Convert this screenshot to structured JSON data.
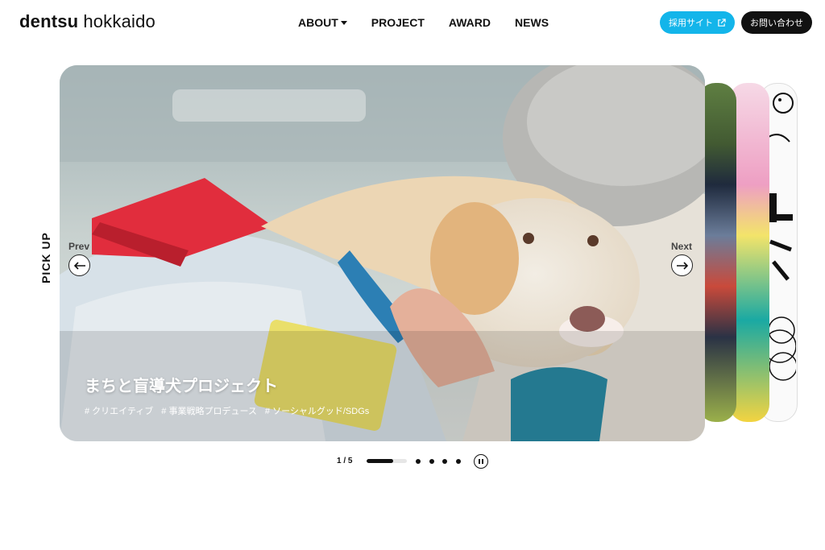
{
  "header": {
    "logo_bold": "dentsu",
    "logo_light": "hokkaido",
    "nav": [
      {
        "label": "ABOUT",
        "has_caret": true
      },
      {
        "label": "PROJECT"
      },
      {
        "label": "AWARD"
      },
      {
        "label": "NEWS"
      }
    ],
    "recruit_label": "採用サイト",
    "contact_label": "お問い合わせ"
  },
  "section_label": "PICK UP",
  "slider": {
    "prev_label": "Prev",
    "next_label": "Next",
    "current": {
      "title": "まちと盲導犬プロジェクト",
      "tags": [
        "# クリエイティブ",
        "# 事業戦略プロデュース",
        "# ソーシャルグッド/SDGs"
      ]
    },
    "counter": "1 / 5",
    "progress": 0.65,
    "dots": 4
  },
  "colors": {
    "recruit_button": "#13b5ea",
    "contact_button": "#111111",
    "text": "#111111"
  },
  "icons": {
    "recruit": "external-link-icon",
    "prev": "arrow-left-icon",
    "next": "arrow-right-icon",
    "pause": "pause-icon",
    "nav_caret": "caret-down-icon"
  }
}
